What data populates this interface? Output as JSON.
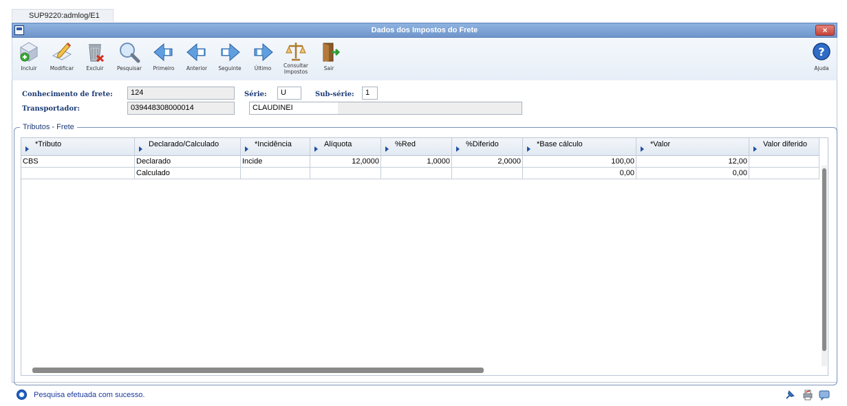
{
  "session": {
    "tab_label": "SUP9220:admlog/E1"
  },
  "window": {
    "title": "Dados dos Impostos do Frete",
    "close_symbol": "×"
  },
  "toolbar": {
    "buttons": [
      {
        "id": "incluir",
        "label": "Incluir",
        "icon": "add-icon"
      },
      {
        "id": "modificar",
        "label": "Modificar",
        "icon": "edit-icon"
      },
      {
        "id": "excluir",
        "label": "Excluir",
        "icon": "trash-icon"
      },
      {
        "id": "pesquisar",
        "label": "Pesquisar",
        "icon": "search-icon"
      },
      {
        "id": "primeiro",
        "label": "Primeiro",
        "icon": "first-arrow-icon"
      },
      {
        "id": "anterior",
        "label": "Anterior",
        "icon": "prev-arrow-icon"
      },
      {
        "id": "seguinte",
        "label": "Seguinte",
        "icon": "next-arrow-icon"
      },
      {
        "id": "ultimo",
        "label": "Último",
        "icon": "last-arrow-icon"
      },
      {
        "id": "consultar",
        "label": "Consultar Impostos",
        "icon": "scales-icon"
      },
      {
        "id": "sair",
        "label": "Sair",
        "icon": "exit-door-icon"
      }
    ],
    "help_label": "Ajuda"
  },
  "form": {
    "conhecimento_label": "Conhecimento de frete:",
    "conhecimento_value": "124",
    "serie_label": "Série:",
    "serie_value": "U",
    "subserie_label": "Sub-série:",
    "subserie_value": "1",
    "transportador_label": "Transportador:",
    "transportador_code": "039448308000014",
    "transportador_name": "CLAUDINEI"
  },
  "group": {
    "title": "Tributos - Frete"
  },
  "table": {
    "columns": [
      "*Tributo",
      "Declarado/Calculado",
      "*Incidência",
      "Alíquota",
      "%Red",
      "%Diferido",
      "*Base cálculo",
      "*Valor",
      "Valor diferido"
    ],
    "rows": [
      [
        "CBS",
        "Declarado",
        "Incide",
        "12,0000",
        "1,0000",
        "2,0000",
        "100,00",
        "12,00",
        ""
      ],
      [
        "",
        "Calculado",
        "",
        "",
        "",
        "",
        "0,00",
        "0,00",
        ""
      ]
    ]
  },
  "status": {
    "message": "Pesquisa efetuada com sucesso."
  },
  "colors": {
    "title_bar": "#7aa0d4",
    "label_text": "#1a3a75",
    "status_text": "#1a3a9e"
  }
}
